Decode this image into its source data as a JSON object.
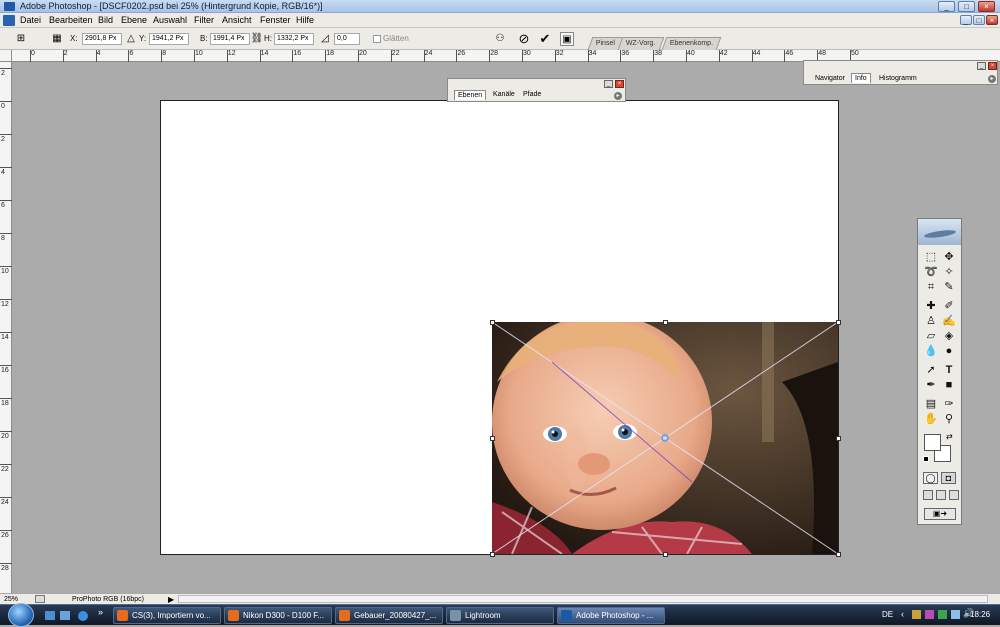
{
  "window": {
    "title": "Adobe Photoshop - [DSCF0202.psd bei 25% (Hintergrund Kopie, RGB/16*)]",
    "app_icon": "photoshop-icon"
  },
  "menu": [
    "Datei",
    "Bearbeiten",
    "Bild",
    "Ebene",
    "Auswahl",
    "Filter",
    "Ansicht",
    "Fenster",
    "Hilfe"
  ],
  "options": {
    "x_label": "X:",
    "x_value": "2901,8 Px",
    "y_label": "Y:",
    "y_value": "1941,2 Px",
    "w_label": "B:",
    "w_value": "1991,4 Px",
    "h_label": "H:",
    "h_value": "1332,2 Px",
    "angle_value": "0,0",
    "smooth_label": "Glätten"
  },
  "dock_tabs": [
    "Pinsel",
    "WZ-Vorg.",
    "Ebenenkomp."
  ],
  "ruler_h": [
    "0",
    "2",
    "4",
    "6",
    "8",
    "10",
    "12",
    "14",
    "16",
    "18",
    "20",
    "22",
    "24",
    "26",
    "28",
    "30",
    "32",
    "34",
    "36",
    "38",
    "40",
    "42",
    "44",
    "46",
    "48",
    "50"
  ],
  "ruler_v": [
    "2",
    "0",
    "2",
    "4",
    "6",
    "8",
    "10",
    "12",
    "14",
    "16",
    "18",
    "20",
    "22",
    "24",
    "26",
    "28"
  ],
  "layers_panel": {
    "tabs": [
      "Ebenen",
      "Kanäle",
      "Pfade"
    ]
  },
  "info_panel": {
    "tabs": [
      "Navigator",
      "Info",
      "Histogramm"
    ]
  },
  "status": {
    "zoom": "25%",
    "profile": "ProPhoto RGB (16bpc)"
  },
  "taskbar": {
    "tasks": [
      "CS(3), Importiern vo...",
      "Nikon D300 - D100 F...",
      "Gebauer_20080427_...",
      "Lightroom",
      "Adobe Photoshop - ..."
    ],
    "language": "DE",
    "time": "18:26"
  },
  "colors": {
    "accent": "#d64733",
    "taskbar": "#1a2940"
  }
}
